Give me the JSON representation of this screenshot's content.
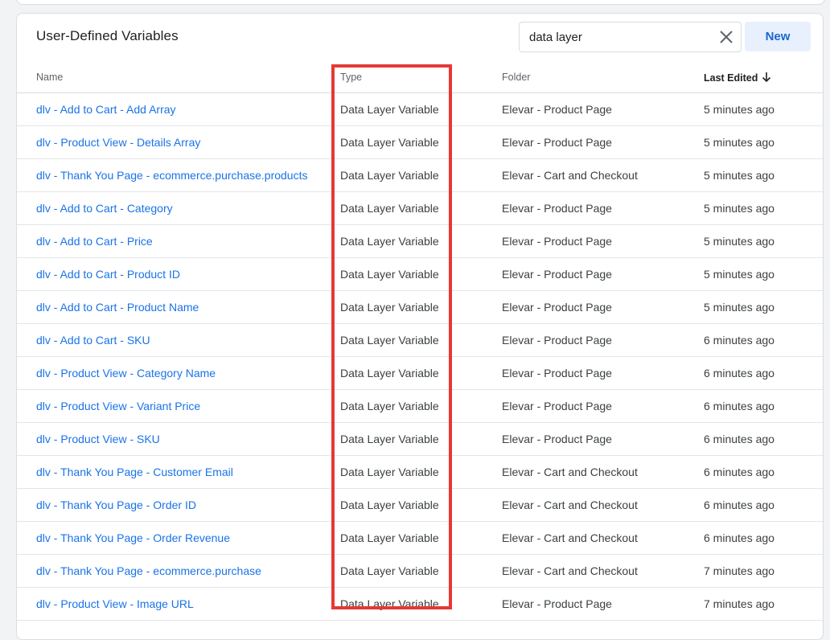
{
  "card": {
    "title": "User-Defined Variables"
  },
  "search": {
    "value": "data layer",
    "clear_icon": "close-icon"
  },
  "toolbar": {
    "new_label": "New"
  },
  "table": {
    "columns": {
      "name": "Name",
      "type": "Type",
      "folder": "Folder",
      "last_edited": "Last Edited"
    },
    "sort_icon": "arrow-down-icon",
    "rows": [
      {
        "name": "dlv - Add to Cart - Add Array",
        "type": "Data Layer Variable",
        "folder": "Elevar - Product Page",
        "edited": "5 minutes ago"
      },
      {
        "name": "dlv - Product View - Details Array",
        "type": "Data Layer Variable",
        "folder": "Elevar - Product Page",
        "edited": "5 minutes ago"
      },
      {
        "name": "dlv - Thank You Page - ecommerce.purchase.products",
        "type": "Data Layer Variable",
        "folder": "Elevar - Cart and Checkout",
        "edited": "5 minutes ago"
      },
      {
        "name": "dlv - Add to Cart - Category",
        "type": "Data Layer Variable",
        "folder": "Elevar - Product Page",
        "edited": "5 minutes ago"
      },
      {
        "name": "dlv - Add to Cart - Price",
        "type": "Data Layer Variable",
        "folder": "Elevar - Product Page",
        "edited": "5 minutes ago"
      },
      {
        "name": "dlv - Add to Cart - Product ID",
        "type": "Data Layer Variable",
        "folder": "Elevar - Product Page",
        "edited": "5 minutes ago"
      },
      {
        "name": "dlv - Add to Cart - Product Name",
        "type": "Data Layer Variable",
        "folder": "Elevar - Product Page",
        "edited": "5 minutes ago"
      },
      {
        "name": "dlv - Add to Cart - SKU",
        "type": "Data Layer Variable",
        "folder": "Elevar - Product Page",
        "edited": "6 minutes ago"
      },
      {
        "name": "dlv - Product View - Category Name",
        "type": "Data Layer Variable",
        "folder": "Elevar - Product Page",
        "edited": "6 minutes ago"
      },
      {
        "name": "dlv - Product View - Variant Price",
        "type": "Data Layer Variable",
        "folder": "Elevar - Product Page",
        "edited": "6 minutes ago"
      },
      {
        "name": "dlv - Product View - SKU",
        "type": "Data Layer Variable",
        "folder": "Elevar - Product Page",
        "edited": "6 minutes ago"
      },
      {
        "name": "dlv - Thank You Page - Customer Email",
        "type": "Data Layer Variable",
        "folder": "Elevar - Cart and Checkout",
        "edited": "6 minutes ago"
      },
      {
        "name": "dlv - Thank You Page - Order ID",
        "type": "Data Layer Variable",
        "folder": "Elevar - Cart and Checkout",
        "edited": "6 minutes ago"
      },
      {
        "name": "dlv - Thank You Page - Order Revenue",
        "type": "Data Layer Variable",
        "folder": "Elevar - Cart and Checkout",
        "edited": "6 minutes ago"
      },
      {
        "name": "dlv - Thank You Page - ecommerce.purchase",
        "type": "Data Layer Variable",
        "folder": "Elevar - Cart and Checkout",
        "edited": "7 minutes ago"
      },
      {
        "name": "dlv - Product View - Image URL",
        "type": "Data Layer Variable",
        "folder": "Elevar - Product Page",
        "edited": "7 minutes ago"
      }
    ]
  },
  "colors": {
    "link": "#1a73e8",
    "highlight": "#e53935",
    "button_bg": "#e8f0fe"
  }
}
